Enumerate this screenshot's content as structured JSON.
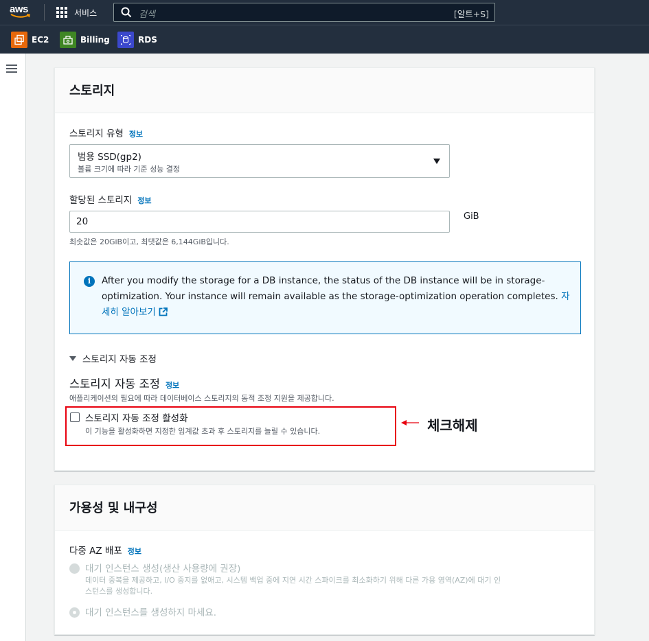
{
  "topbar": {
    "logo_text": "aws",
    "services_label": "서비스",
    "search_placeholder": "검색",
    "search_shortcut": "[알트+S]"
  },
  "favorites": [
    {
      "label": "EC2",
      "icon": "ec2-icon",
      "color": "#e7680b"
    },
    {
      "label": "Billing",
      "icon": "billing-icon",
      "color": "#3f8624"
    },
    {
      "label": "RDS",
      "icon": "rds-icon",
      "color": "#3b48cc"
    }
  ],
  "storage": {
    "title": "스토리지",
    "type_label": "스토리지 유형",
    "info_label": "정보",
    "type_value": "범용 SSD(gp2)",
    "type_description": "볼륨 크기에 따라 기준 성능 결정",
    "allocated_label": "할당된 스토리지",
    "allocated_value": "20",
    "unit": "GiB",
    "allocated_hint": "최솟값은 20GiB이고, 최댓값은 6,144GiB입니다.",
    "alert_text": "After you modify the storage for a DB instance, the status of the DB instance will be in storage-optimization. Your instance will remain available as the storage-optimization operation completes.",
    "alert_link_part1": "자",
    "alert_link_part2": "세히 알아보기",
    "autoscaling_expander": "스토리지 자동 조정",
    "autoscaling_title": "스토리지 자동 조정",
    "autoscaling_desc": "애플리케이션의 필요에 따라 데이터베이스 스토리지의 동적 조정 지원을 제공합니다.",
    "autoscaling_checkbox_label": "스토리지 자동 조정 활성화",
    "autoscaling_checkbox_desc": "이 기능을 활성화하면 지정한 임계값 초과 후 스토리지를 늘릴 수 있습니다.",
    "autoscaling_checked": false,
    "annotation_text": "체크해제",
    "annotation_color": "#e8000e"
  },
  "availability": {
    "title": "가용성 및 내구성",
    "multi_az_label": "다중 AZ 배포",
    "info_label": "정보",
    "option1_label": "대기 인스턴스 생성(생산 사용량에 권장)",
    "option1_desc_line1": "데이터 중복을 제공하고, I/O 중지를 없애고, 시스템 백업 중에 지연 시간 스파이크를 최소화하기 위해 다른 가용 영역(AZ)에 대기 인",
    "option1_desc_line2": "스턴스를 생성합니다.",
    "option2_label": "대기 인스턴스를 생성하지 마세요.",
    "selected_option": 2
  }
}
